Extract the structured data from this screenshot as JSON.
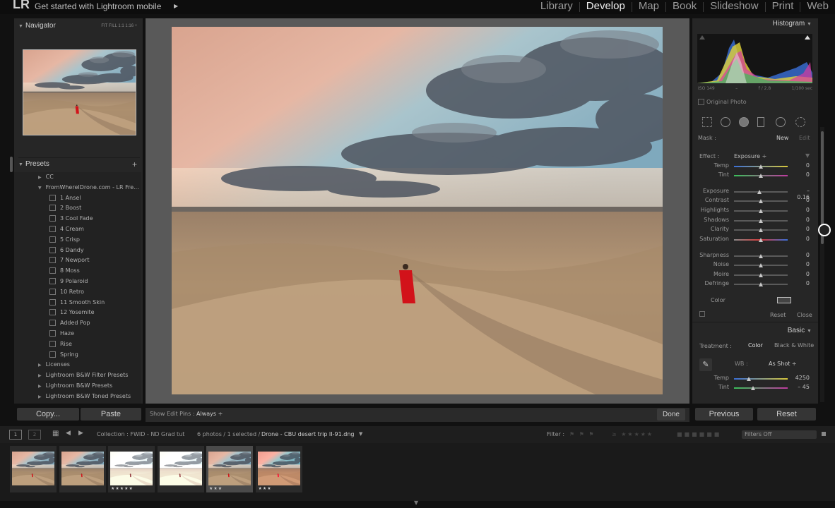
{
  "topbar": {
    "logo": "LR",
    "mobile_link": "Get started with Lightroom mobile",
    "modules": [
      {
        "label": "Library",
        "active": false
      },
      {
        "label": "Develop",
        "active": true
      },
      {
        "label": "Map",
        "active": false
      },
      {
        "label": "Book",
        "active": false
      },
      {
        "label": "Slideshow",
        "active": false
      },
      {
        "label": "Print",
        "active": false
      },
      {
        "label": "Web",
        "active": false
      }
    ]
  },
  "left_panel": {
    "navigator": {
      "title": "Navigator",
      "zoom": "FIT   FILL   1:1   1:16 ÷"
    },
    "presets": {
      "title": "Presets",
      "items": [
        {
          "label": "CC",
          "kind": "folder-collapsed",
          "indent": 1
        },
        {
          "label": "FromWhereIDrone.com - LR Fre...",
          "kind": "folder-open",
          "indent": 1
        },
        {
          "label": "1 Ansel",
          "kind": "preset",
          "indent": 2
        },
        {
          "label": "2 Boost",
          "kind": "preset",
          "indent": 2
        },
        {
          "label": "3 Cool Fade",
          "kind": "preset",
          "indent": 2
        },
        {
          "label": "4 Cream",
          "kind": "preset",
          "indent": 2
        },
        {
          "label": "5 Crisp",
          "kind": "preset",
          "indent": 2
        },
        {
          "label": "6 Dandy",
          "kind": "preset",
          "indent": 2
        },
        {
          "label": "7 Newport",
          "kind": "preset",
          "indent": 2
        },
        {
          "label": "8 Moss",
          "kind": "preset",
          "indent": 2
        },
        {
          "label": "9 Polaroid",
          "kind": "preset",
          "indent": 2
        },
        {
          "label": "10 Retro",
          "kind": "preset",
          "indent": 2
        },
        {
          "label": "11 Smooth Skin",
          "kind": "preset",
          "indent": 2
        },
        {
          "label": "12 Yosemite",
          "kind": "preset",
          "indent": 2
        },
        {
          "label": "Added Pop",
          "kind": "preset",
          "indent": 2
        },
        {
          "label": "Haze",
          "kind": "preset",
          "indent": 2
        },
        {
          "label": "Rise",
          "kind": "preset",
          "indent": 2
        },
        {
          "label": "Spring",
          "kind": "preset",
          "indent": 2
        },
        {
          "label": "Licenses",
          "kind": "folder-collapsed",
          "indent": 1
        },
        {
          "label": "Lightroom B&W Filter Presets",
          "kind": "folder-collapsed",
          "indent": 1
        },
        {
          "label": "Lightroom B&W Presets",
          "kind": "folder-collapsed",
          "indent": 1
        },
        {
          "label": "Lightroom B&W Toned Presets",
          "kind": "folder-collapsed",
          "indent": 1
        }
      ]
    },
    "copy_label": "Copy...",
    "paste_label": "Paste"
  },
  "center": {
    "show_edit_pins_label": "Show Edit Pins :",
    "show_edit_pins_value": "Always ÷",
    "done_label": "Done"
  },
  "right_panel": {
    "histogram_title": "Histogram",
    "hist_meta": [
      "ISO 149",
      "–",
      "f / 2.8",
      "1/100 sec"
    ],
    "original_photo": "Original Photo",
    "mask_label": "Mask :",
    "mask_new": "New",
    "mask_edit": "Edit",
    "effect_label": "Effect :",
    "effect_value": "Exposure ÷",
    "sliders": [
      {
        "label": "Temp",
        "value": "0",
        "pos": 0.5,
        "track": "temp"
      },
      {
        "label": "Tint",
        "value": "0",
        "pos": 0.5,
        "track": "tint"
      },
      {
        "label": "Exposure",
        "value": "– 0.16",
        "pos": 0.48,
        "track": "gray"
      },
      {
        "label": "Contrast",
        "value": "0",
        "pos": 0.5,
        "track": "gray"
      },
      {
        "label": "Highlights",
        "value": "0",
        "pos": 0.5,
        "track": "gray"
      },
      {
        "label": "Shadows",
        "value": "0",
        "pos": 0.5,
        "track": "gray"
      },
      {
        "label": "Clarity",
        "value": "0",
        "pos": 0.5,
        "track": "gray"
      },
      {
        "label": "Saturation",
        "value": "0",
        "pos": 0.5,
        "track": "sat"
      },
      {
        "label": "Sharpness",
        "value": "0",
        "pos": 0.5,
        "track": "gray"
      },
      {
        "label": "Noise",
        "value": "0",
        "pos": 0.5,
        "track": "gray"
      },
      {
        "label": "Moire",
        "value": "0",
        "pos": 0.5,
        "track": "gray"
      },
      {
        "label": "Defringe",
        "value": "0",
        "pos": 0.5,
        "track": "gray"
      }
    ],
    "color_label": "Color",
    "reset_label": "Reset",
    "close_label": "Close",
    "basic_title": "Basic",
    "treatment_label": "Treatment :",
    "treatment_color": "Color",
    "treatment_bw": "Black & White",
    "wb_label": "WB :",
    "wb_value": "As Shot ÷",
    "basic_sliders": [
      {
        "label": "Temp",
        "value": "4250",
        "pos": 0.27,
        "track": "temp"
      },
      {
        "label": "Tint",
        "value": "– 45",
        "pos": 0.36,
        "track": "tint"
      }
    ],
    "previous_label": "Previous",
    "reset_button_label": "Reset"
  },
  "filmstrip_bar": {
    "screen1": "1",
    "screen2": "2",
    "collection": "Collection : FWID - ND Grad tut",
    "count": "6 photos / 1 selected /",
    "filename": "Drone - CBU desert trip II-91.dng",
    "filter_label": "Filter :",
    "filters_off": "Filters Off"
  },
  "filmstrip": [
    {
      "variant": "dune",
      "stars": "",
      "selected": false
    },
    {
      "variant": "dune",
      "stars": "",
      "selected": false
    },
    {
      "variant": "bright",
      "stars": "★★★★★",
      "selected": false
    },
    {
      "variant": "bright",
      "stars": "",
      "selected": false
    },
    {
      "variant": "dune",
      "stars": "★★★",
      "selected": true
    },
    {
      "variant": "warm",
      "stars": "★★★",
      "selected": false
    }
  ]
}
